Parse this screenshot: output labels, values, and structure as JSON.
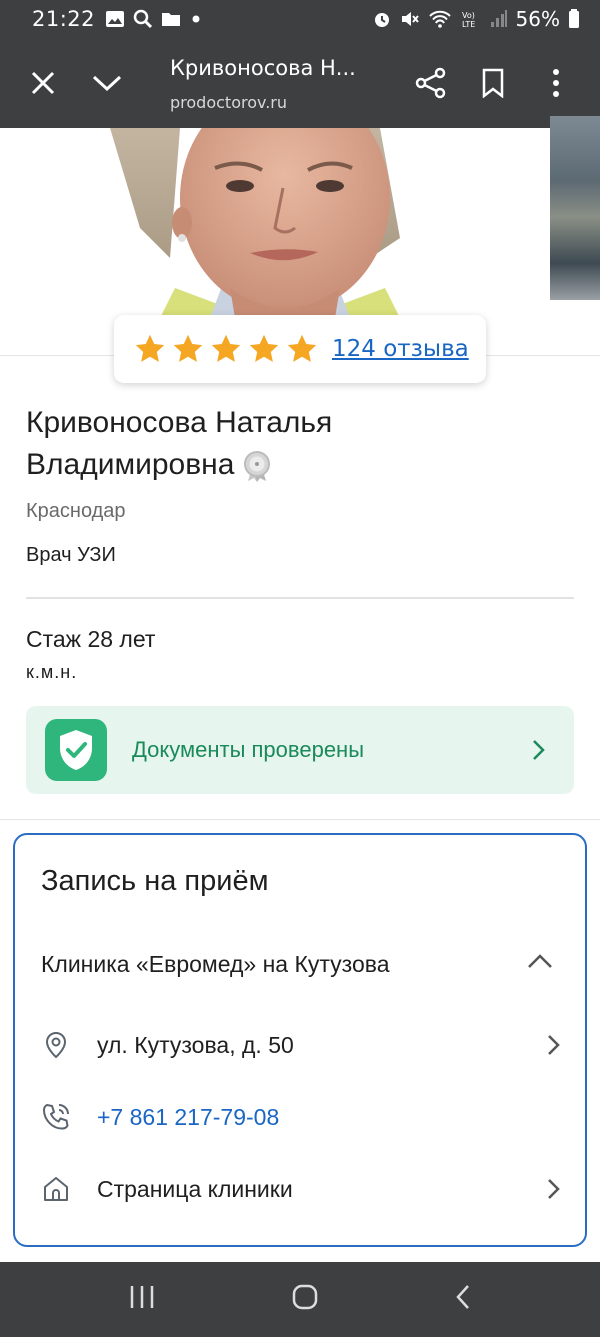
{
  "status_bar": {
    "time": "21:22",
    "battery_percent": "56%",
    "left_icons": [
      "image-icon",
      "search-icon",
      "folder-icon",
      "dot-icon"
    ],
    "right_icons": [
      "alarm-icon",
      "mute-icon",
      "wifi-icon",
      "volte-icon",
      "signal-icon",
      "battery-icon"
    ]
  },
  "browser": {
    "title": "Кривоносова Н...",
    "url": "prodoctorov.ru",
    "icons": [
      "close-icon",
      "chevron-down-icon",
      "share-icon",
      "bookmark-icon",
      "more-icon"
    ]
  },
  "rating": {
    "stars": 5,
    "reviews_label": "124 отзыва",
    "star_color": "#f5a623"
  },
  "doctor": {
    "name": "Кривоносова Наталья Владимировна",
    "city": "Краснодар",
    "specialty": "Врач УЗИ",
    "experience": "Стаж 28 лет",
    "degree": "к.м.н."
  },
  "documents": {
    "label": "Документы проверены",
    "accent": "#2eb67d"
  },
  "booking": {
    "title": "Запись на приём",
    "clinic_name": "Клиника «Евромед» на Кутузова",
    "address": "ул. Кутузова, д. 50",
    "phone": "+7 861 217-79-08",
    "clinic_page": "Страница клиники",
    "border_color": "#2b6cc4",
    "link_color": "#1a66c4"
  },
  "nav_bar": {
    "icons": [
      "recent-apps-icon",
      "home-icon",
      "back-icon"
    ]
  }
}
